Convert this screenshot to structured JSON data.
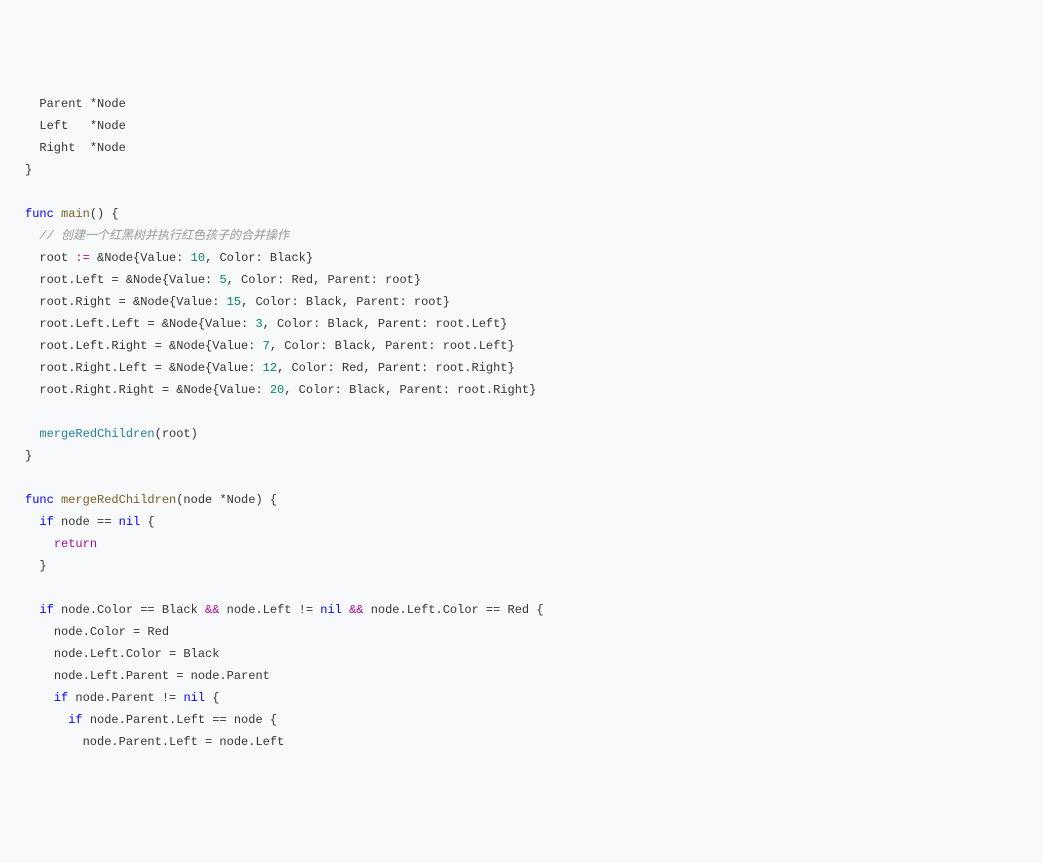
{
  "lines": [
    {
      "indent": "  ",
      "tokens": [
        {
          "t": "Parent *",
          "c": ""
        },
        {
          "t": "Node",
          "c": "type"
        }
      ]
    },
    {
      "indent": "  ",
      "tokens": [
        {
          "t": "Left   *",
          "c": ""
        },
        {
          "t": "Node",
          "c": "type"
        }
      ]
    },
    {
      "indent": "  ",
      "tokens": [
        {
          "t": "Right  *",
          "c": ""
        },
        {
          "t": "Node",
          "c": "type"
        }
      ]
    },
    {
      "indent": "",
      "tokens": [
        {
          "t": "}",
          "c": ""
        }
      ]
    },
    {
      "indent": "",
      "tokens": []
    },
    {
      "indent": "",
      "tokens": [
        {
          "t": "func",
          "c": "kw"
        },
        {
          "t": " ",
          "c": ""
        },
        {
          "t": "main",
          "c": "func-name"
        },
        {
          "t": "() {",
          "c": ""
        }
      ]
    },
    {
      "indent": "  ",
      "tokens": [
        {
          "t": "// 创建一个红黑树并执行红色孩子的合并操作",
          "c": "comment"
        }
      ]
    },
    {
      "indent": "  ",
      "tokens": [
        {
          "t": "root ",
          "c": ""
        },
        {
          "t": ":=",
          "c": "op"
        },
        {
          "t": " &",
          "c": ""
        },
        {
          "t": "Node",
          "c": "type"
        },
        {
          "t": "{Value: ",
          "c": ""
        },
        {
          "t": "10",
          "c": "num"
        },
        {
          "t": ", Color: Black}",
          "c": ""
        }
      ]
    },
    {
      "indent": "  ",
      "tokens": [
        {
          "t": "root.Left = &",
          "c": ""
        },
        {
          "t": "Node",
          "c": "type"
        },
        {
          "t": "{Value: ",
          "c": ""
        },
        {
          "t": "5",
          "c": "num"
        },
        {
          "t": ", Color: Red, Parent: root}",
          "c": ""
        }
      ]
    },
    {
      "indent": "  ",
      "tokens": [
        {
          "t": "root.Right = &",
          "c": ""
        },
        {
          "t": "Node",
          "c": "type"
        },
        {
          "t": "{Value: ",
          "c": ""
        },
        {
          "t": "15",
          "c": "num"
        },
        {
          "t": ", Color: Black, Parent: root}",
          "c": ""
        }
      ]
    },
    {
      "indent": "  ",
      "tokens": [
        {
          "t": "root.Left.Left = &",
          "c": ""
        },
        {
          "t": "Node",
          "c": "type"
        },
        {
          "t": "{Value: ",
          "c": ""
        },
        {
          "t": "3",
          "c": "num"
        },
        {
          "t": ", Color: Black, Parent: root.Left}",
          "c": ""
        }
      ]
    },
    {
      "indent": "  ",
      "tokens": [
        {
          "t": "root.Left.Right = &",
          "c": ""
        },
        {
          "t": "Node",
          "c": "type"
        },
        {
          "t": "{Value: ",
          "c": ""
        },
        {
          "t": "7",
          "c": "num"
        },
        {
          "t": ", Color: Black, Parent: root.Left}",
          "c": ""
        }
      ]
    },
    {
      "indent": "  ",
      "tokens": [
        {
          "t": "root.Right.Left = &",
          "c": ""
        },
        {
          "t": "Node",
          "c": "type"
        },
        {
          "t": "{Value: ",
          "c": ""
        },
        {
          "t": "12",
          "c": "num"
        },
        {
          "t": ", Color: Red, Parent: root.Right}",
          "c": ""
        }
      ]
    },
    {
      "indent": "  ",
      "tokens": [
        {
          "t": "root.Right.Right = &",
          "c": ""
        },
        {
          "t": "Node",
          "c": "type"
        },
        {
          "t": "{Value: ",
          "c": ""
        },
        {
          "t": "20",
          "c": "num"
        },
        {
          "t": ", Color: Black, Parent: root.Right}",
          "c": ""
        }
      ]
    },
    {
      "indent": "",
      "tokens": []
    },
    {
      "indent": "  ",
      "tokens": [
        {
          "t": "mergeRedChildren",
          "c": "func-call"
        },
        {
          "t": "(root)",
          "c": ""
        }
      ]
    },
    {
      "indent": "",
      "tokens": [
        {
          "t": "}",
          "c": ""
        }
      ]
    },
    {
      "indent": "",
      "tokens": []
    },
    {
      "indent": "",
      "tokens": [
        {
          "t": "func",
          "c": "kw"
        },
        {
          "t": " ",
          "c": ""
        },
        {
          "t": "mergeRedChildren",
          "c": "func-name"
        },
        {
          "t": "(node *",
          "c": ""
        },
        {
          "t": "Node",
          "c": "type"
        },
        {
          "t": ") {",
          "c": ""
        }
      ]
    },
    {
      "indent": "  ",
      "tokens": [
        {
          "t": "if",
          "c": "kw"
        },
        {
          "t": " node == ",
          "c": ""
        },
        {
          "t": "nil",
          "c": "nil"
        },
        {
          "t": " {",
          "c": ""
        }
      ]
    },
    {
      "indent": "    ",
      "tokens": [
        {
          "t": "return",
          "c": "ret"
        }
      ]
    },
    {
      "indent": "  ",
      "tokens": [
        {
          "t": "}",
          "c": ""
        }
      ]
    },
    {
      "indent": "",
      "tokens": []
    },
    {
      "indent": "  ",
      "tokens": [
        {
          "t": "if",
          "c": "kw"
        },
        {
          "t": " node.Color == Black ",
          "c": ""
        },
        {
          "t": "&&",
          "c": "op"
        },
        {
          "t": " node.Left != ",
          "c": ""
        },
        {
          "t": "nil",
          "c": "nil"
        },
        {
          "t": " ",
          "c": ""
        },
        {
          "t": "&&",
          "c": "op"
        },
        {
          "t": " node.Left.Color == Red {",
          "c": ""
        }
      ]
    },
    {
      "indent": "    ",
      "tokens": [
        {
          "t": "node.Color = Red",
          "c": ""
        }
      ]
    },
    {
      "indent": "    ",
      "tokens": [
        {
          "t": "node.Left.Color = Black",
          "c": ""
        }
      ]
    },
    {
      "indent": "    ",
      "tokens": [
        {
          "t": "node.Left.Parent = node.Parent",
          "c": ""
        }
      ]
    },
    {
      "indent": "    ",
      "tokens": [
        {
          "t": "if",
          "c": "kw"
        },
        {
          "t": " node.Parent != ",
          "c": ""
        },
        {
          "t": "nil",
          "c": "nil"
        },
        {
          "t": " {",
          "c": ""
        }
      ]
    },
    {
      "indent": "      ",
      "tokens": [
        {
          "t": "if",
          "c": "kw"
        },
        {
          "t": " node.Parent.Left == node {",
          "c": ""
        }
      ]
    },
    {
      "indent": "        ",
      "tokens": [
        {
          "t": "node.Parent.Left = node.Left",
          "c": ""
        }
      ]
    }
  ]
}
